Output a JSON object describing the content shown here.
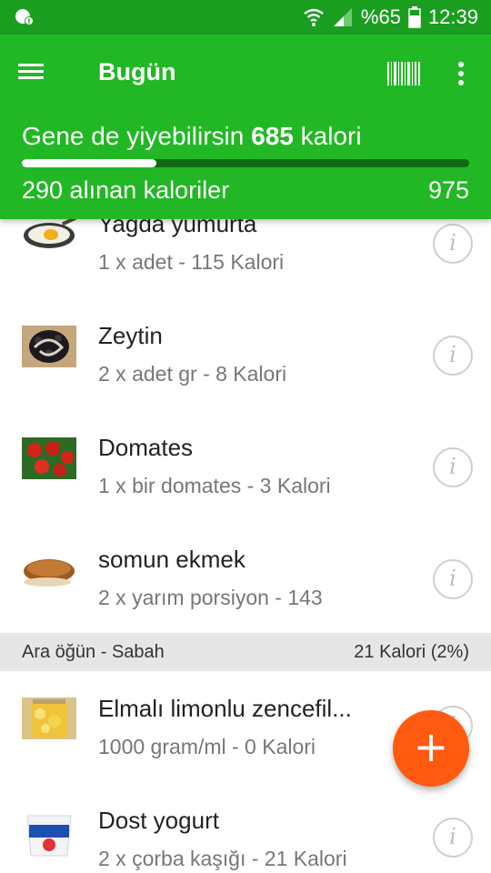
{
  "status_bar": {
    "battery": "%65",
    "time": "12:39",
    "icons": [
      "notification-icon",
      "wifi-icon",
      "signal-icon",
      "battery-icon"
    ]
  },
  "app_bar": {
    "title": "Bugün",
    "icons": [
      "menu-icon",
      "barcode-icon",
      "more-vert-icon"
    ],
    "remaining_prefix": "Gene de yiyebilirsin",
    "remaining_value": "685",
    "remaining_suffix": "kalori",
    "consumed_label": "290 alınan kaloriler",
    "goal": "975",
    "progress_fraction": 0.3
  },
  "items": [
    {
      "name": "Yağda yumurta",
      "detail": "1 x adet - 115 Kalori",
      "thumb": "fried-egg"
    },
    {
      "name": "Zeytin",
      "detail": "2 x adet gr - 8 Kalori",
      "thumb": "olives"
    },
    {
      "name": "Domates",
      "detail": "1 x bir domates - 3 Kalori",
      "thumb": "tomatoes"
    },
    {
      "name": "somun ekmek",
      "detail": "2 x yarım porsiyon - 143",
      "thumb": "bread"
    }
  ],
  "section": {
    "label": "Ara öğün - Sabah",
    "summary": "21 Kalori (2%)"
  },
  "snack_items": [
    {
      "name": "Elmalı limonlu zencefil...",
      "detail": "1000 gram/ml - 0 Kalori",
      "thumb": "lemon-jar"
    },
    {
      "name": "Dost yogurt",
      "detail": "2 x çorba kaşığı - 21 Kalori",
      "thumb": "yogurt-cup"
    }
  ],
  "info_glyph": "i",
  "fab_glyph": "+",
  "colors": {
    "status_bar": "#1a9e1f",
    "app_bar": "#22b825",
    "fab": "#ff5a10",
    "section_bg": "#e6e6e6"
  }
}
